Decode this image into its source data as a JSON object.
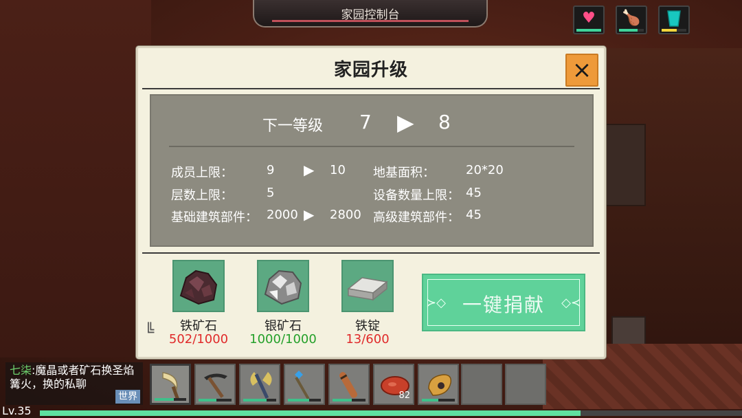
{
  "top_bar": {
    "title": "家园控制台"
  },
  "status": {
    "heart": {
      "icon": "heart-icon",
      "color": "#ff4f88",
      "level": 1.0
    },
    "food": {
      "icon": "meat-icon",
      "color": "#f6d04a",
      "level": 0.75
    },
    "water": {
      "icon": "water-cup-icon",
      "color": "#18c8c0",
      "level": 0.6
    }
  },
  "dialog": {
    "title": "家园升级",
    "close_label": "×",
    "level": {
      "label": "下一等级",
      "from": "7",
      "arrow": "▶",
      "to": "8"
    },
    "stats": {
      "members_label": "成员上限：",
      "members_from": "9",
      "members_to": "10",
      "floors_label": "层数上限：",
      "floors_value": "5",
      "basic_label": "基础建筑部件：",
      "basic_from": "2000",
      "basic_to": "2800",
      "area_label": "地基面积：",
      "area_value": "20*20",
      "devices_label": "设备数量上限：",
      "devices_value": "45",
      "advanced_label": "高级建筑部件：",
      "advanced_value": "45"
    },
    "materials": [
      {
        "name": "铁矿石",
        "qty": "502/1000",
        "status": "insufficient",
        "icon": "iron-ore-icon"
      },
      {
        "name": "银矿石",
        "qty": "1000/1000",
        "status": "complete",
        "icon": "silver-ore-icon"
      },
      {
        "name": "铁锭",
        "qty": "13/600",
        "status": "insufficient",
        "icon": "iron-ingot-icon"
      }
    ],
    "donate_label": "一键捐献"
  },
  "chat": {
    "sender": "七柒",
    "separator": ":",
    "message": "魔晶或者矿石换圣焰篝火，换的私聊",
    "channel": "世界"
  },
  "hotbar": [
    {
      "icon": "sickle-icon",
      "selected": true
    },
    {
      "icon": "pickaxe-icon"
    },
    {
      "icon": "battle-axe-icon"
    },
    {
      "icon": "crystal-staff-icon"
    },
    {
      "icon": "wooden-club-icon"
    },
    {
      "icon": "meat-steak-icon",
      "count": "82"
    },
    {
      "icon": "horn-bag-icon"
    },
    {
      "icon": "empty-slot"
    },
    {
      "icon": "empty-slot"
    }
  ],
  "player": {
    "level": "Lv.35",
    "xp_fraction": 0.77
  }
}
